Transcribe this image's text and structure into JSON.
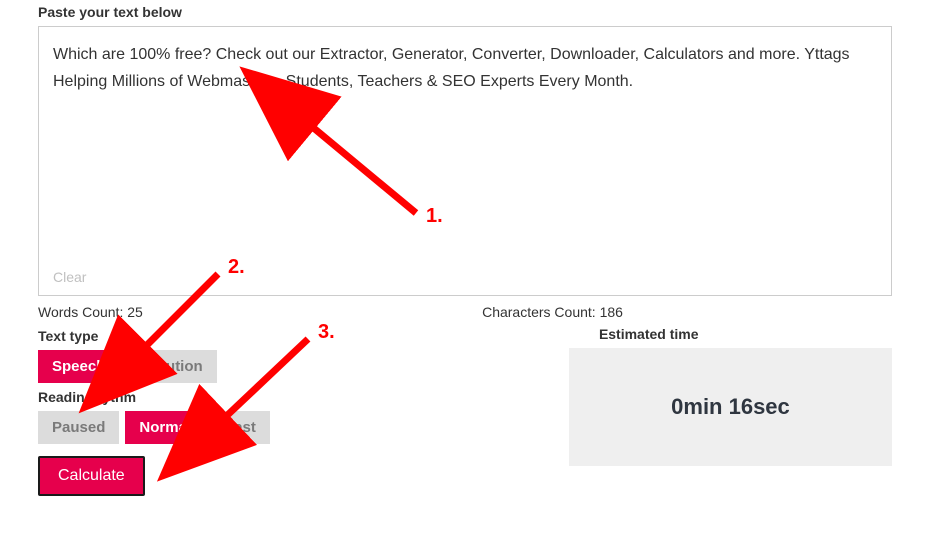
{
  "labels": {
    "paste_prompt": "Paste your text below",
    "clear": "Clear",
    "text_type": "Text type",
    "reading_rythm": "Reading rythm",
    "estimated_time": "Estimated time"
  },
  "textarea": {
    "value": "Which are 100% free? Check out our Extractor, Generator, Converter, Downloader, Calculators and more. Yttags Helping Millions of Webmasters, Students, Teachers & SEO Experts Every Month."
  },
  "counts": {
    "words_label": "Words Count: ",
    "words_value": "25",
    "chars_label": "Characters Count: ",
    "chars_value": "186"
  },
  "text_type": {
    "options": [
      "Speech",
      "Locution"
    ],
    "selected": "Speech"
  },
  "reading_rythm": {
    "options": [
      "Paused",
      "Normal",
      "Fast"
    ],
    "selected": "Normal"
  },
  "buttons": {
    "calculate": "Calculate"
  },
  "result": {
    "time": "0min 16sec"
  },
  "annotations": {
    "a1": "1.",
    "a2": "2.",
    "a3": "3."
  }
}
